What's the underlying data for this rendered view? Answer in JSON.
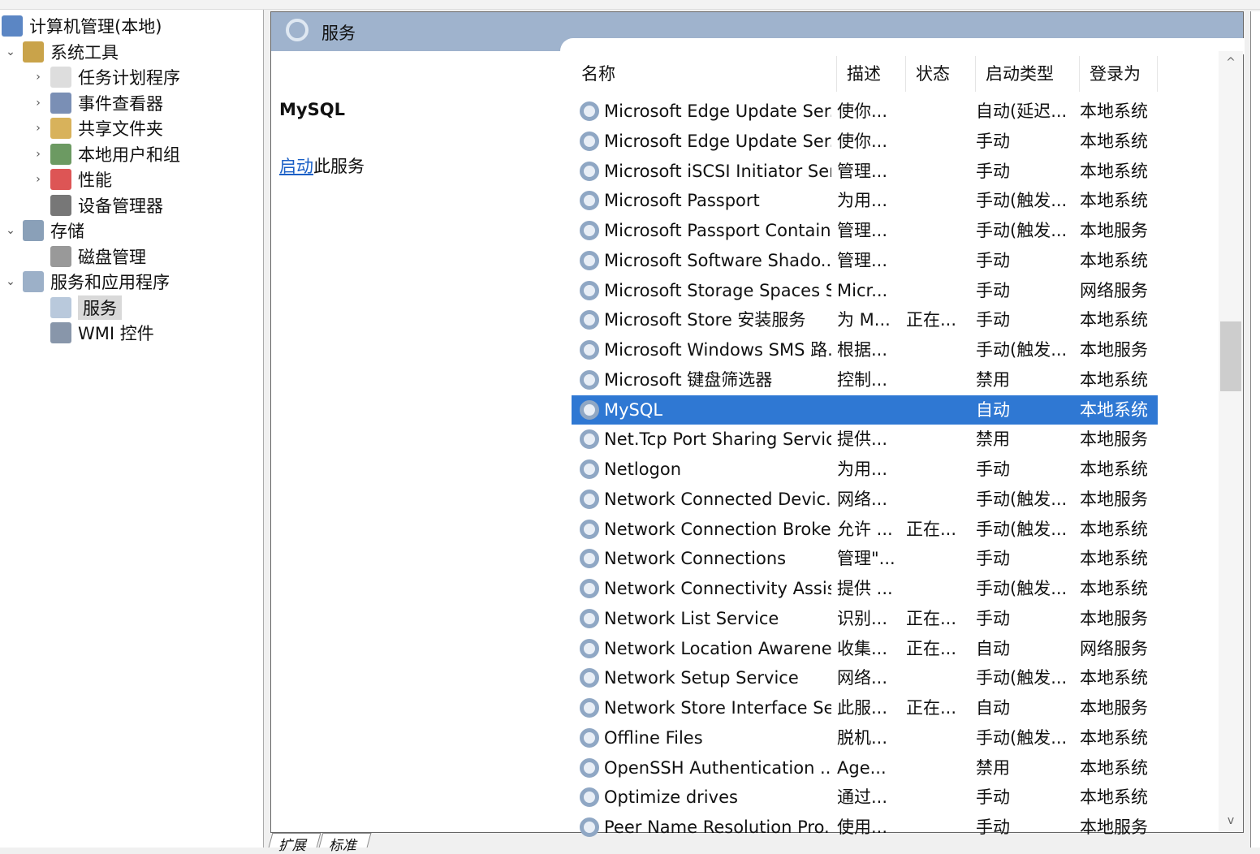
{
  "tree": [
    {
      "label": "计算机管理(本地)",
      "level": 0,
      "chev": "",
      "icon": "computer-icon"
    },
    {
      "label": "系统工具",
      "level": 1,
      "chev": "⌄",
      "icon": "tools-icon"
    },
    {
      "label": "任务计划程序",
      "level": 2,
      "chev": "›",
      "icon": "clock-icon"
    },
    {
      "label": "事件查看器",
      "level": 2,
      "chev": "›",
      "icon": "event-log-icon"
    },
    {
      "label": "共享文件夹",
      "level": 2,
      "chev": "›",
      "icon": "shared-folder-icon"
    },
    {
      "label": "本地用户和组",
      "level": 2,
      "chev": "›",
      "icon": "users-icon"
    },
    {
      "label": "性能",
      "level": 2,
      "chev": "›",
      "icon": "performance-icon"
    },
    {
      "label": "设备管理器",
      "level": 2,
      "chev": "",
      "icon": "device-manager-icon"
    },
    {
      "label": "存储",
      "level": 1,
      "chev": "⌄",
      "icon": "storage-icon"
    },
    {
      "label": "磁盘管理",
      "level": 2,
      "chev": "",
      "icon": "disk-icon"
    },
    {
      "label": "服务和应用程序",
      "level": 1,
      "chev": "⌄",
      "icon": "services-apps-icon"
    },
    {
      "label": "服务",
      "level": 2,
      "chev": "",
      "icon": "services-gear-icon",
      "selected": true
    },
    {
      "label": "WMI 控件",
      "level": 2,
      "chev": "",
      "icon": "wmi-icon"
    }
  ],
  "header": {
    "title": "服务"
  },
  "extended": {
    "service_name": "MySQL",
    "start_link": "启动",
    "start_suffix": "此服务"
  },
  "columns": [
    "名称",
    "描述",
    "状态",
    "启动类型",
    "登录为"
  ],
  "rows": [
    [
      "Microsoft Edge Update Ser...",
      "使你...",
      "",
      "自动(延迟...",
      "本地系统"
    ],
    [
      "Microsoft Edge Update Ser...",
      "使你...",
      "",
      "手动",
      "本地系统"
    ],
    [
      "Microsoft iSCSI Initiator Ser...",
      "管理...",
      "",
      "手动",
      "本地系统"
    ],
    [
      "Microsoft Passport",
      "为用...",
      "",
      "手动(触发...",
      "本地系统"
    ],
    [
      "Microsoft Passport Container",
      "管理...",
      "",
      "手动(触发...",
      "本地服务"
    ],
    [
      "Microsoft Software Shado...",
      "管理...",
      "",
      "手动",
      "本地系统"
    ],
    [
      "Microsoft Storage Spaces S...",
      "Micr...",
      "",
      "手动",
      "网络服务"
    ],
    [
      "Microsoft Store 安装服务",
      "为 M...",
      "正在...",
      "手动",
      "本地系统"
    ],
    [
      "Microsoft Windows SMS 路...",
      "根据...",
      "",
      "手动(触发...",
      "本地服务"
    ],
    [
      "Microsoft 键盘筛选器",
      "控制...",
      "",
      "禁用",
      "本地系统"
    ],
    [
      "MySQL",
      "",
      "",
      "自动",
      "本地系统"
    ],
    [
      "Net.Tcp Port Sharing Service",
      "提供...",
      "",
      "禁用",
      "本地服务"
    ],
    [
      "Netlogon",
      "为用...",
      "",
      "手动",
      "本地系统"
    ],
    [
      "Network Connected Devic...",
      "网络...",
      "",
      "手动(触发...",
      "本地服务"
    ],
    [
      "Network Connection Broker",
      "允许 ...",
      "正在...",
      "手动(触发...",
      "本地系统"
    ],
    [
      "Network Connections",
      "管理\"...",
      "",
      "手动",
      "本地系统"
    ],
    [
      "Network Connectivity Assis...",
      "提供 ...",
      "",
      "手动(触发...",
      "本地系统"
    ],
    [
      "Network List Service",
      "识别...",
      "正在...",
      "手动",
      "本地服务"
    ],
    [
      "Network Location Awarene...",
      "收集...",
      "正在...",
      "自动",
      "网络服务"
    ],
    [
      "Network Setup Service",
      "网络...",
      "",
      "手动(触发...",
      "本地系统"
    ],
    [
      "Network Store Interface Se...",
      "此服...",
      "正在...",
      "自动",
      "本地服务"
    ],
    [
      "Offline Files",
      "脱机...",
      "",
      "手动(触发...",
      "本地系统"
    ],
    [
      "OpenSSH Authentication ...",
      "Age...",
      "",
      "禁用",
      "本地系统"
    ],
    [
      "Optimize drives",
      "通过...",
      "",
      "手动",
      "本地系统"
    ],
    [
      "Peer Name Resolution Pro...",
      "使用...",
      "",
      "手动",
      "本地服务"
    ]
  ],
  "selected_row": 10,
  "tabs": [
    "扩展",
    "标准"
  ],
  "colors": {
    "header_bar": "#9fb3cd",
    "selection": "#2f78d3",
    "link": "#1a5fc6"
  }
}
